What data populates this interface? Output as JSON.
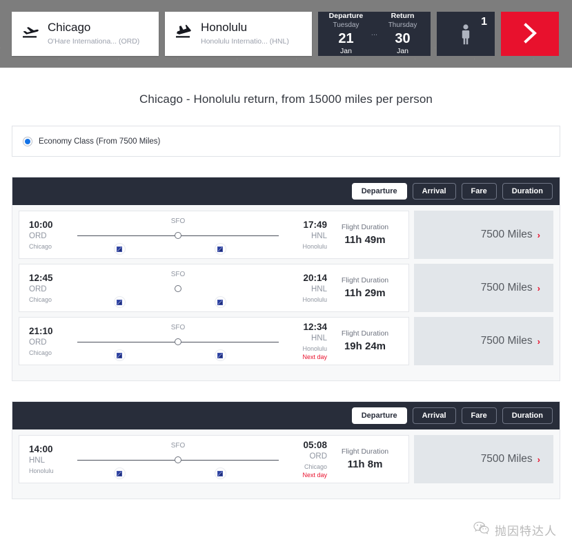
{
  "header": {
    "origin": {
      "icon": "plane-takeoff-icon",
      "city": "Chicago",
      "airport": "O'Hare Internationa... (ORD)"
    },
    "destination": {
      "icon": "plane-landing-icon",
      "city": "Honolulu",
      "airport": "Honolulu Internatio... (HNL)"
    },
    "dates": {
      "departure_label": "Departure",
      "departure_dow": "Tuesday",
      "departure_day": "21",
      "departure_month": "Jan",
      "separator": "...",
      "return_label": "Return",
      "return_dow": "Thursday",
      "return_day": "30",
      "return_month": "Jan"
    },
    "passengers": {
      "count": "1",
      "icon": "person-icon"
    },
    "submit": {
      "icon": "chevron-right-icon",
      "color": "#e8112d"
    }
  },
  "page_title": "Chicago - Honolulu return, from 15000 miles per person",
  "cabin": {
    "selected": true,
    "label": "Economy Class (From 7500 Miles)"
  },
  "sort_tabs": [
    {
      "label": "Departure",
      "active": true
    },
    {
      "label": "Arrival",
      "active": false
    },
    {
      "label": "Fare",
      "active": false
    },
    {
      "label": "Duration",
      "active": false
    }
  ],
  "outbound": {
    "flights": [
      {
        "depart_time": "10:00",
        "depart_code": "ORD",
        "depart_city": "Chicago",
        "stop": "SFO",
        "has_line": true,
        "arrive_time": "17:49",
        "arrive_code": "HNL",
        "arrive_city": "Honolulu",
        "next_day": "",
        "duration_label": "Flight Duration",
        "duration_value": "11h 49m",
        "price": "7500 Miles"
      },
      {
        "depart_time": "12:45",
        "depart_code": "ORD",
        "depart_city": "Chicago",
        "stop": "SFO",
        "has_line": false,
        "arrive_time": "20:14",
        "arrive_code": "HNL",
        "arrive_city": "Honolulu",
        "next_day": "",
        "duration_label": "Flight Duration",
        "duration_value": "11h 29m",
        "price": "7500 Miles"
      },
      {
        "depart_time": "21:10",
        "depart_code": "ORD",
        "depart_city": "Chicago",
        "stop": "SFO",
        "has_line": true,
        "arrive_time": "12:34",
        "arrive_code": "HNL",
        "arrive_city": "Honolulu",
        "next_day": "Next day",
        "duration_label": "Flight Duration",
        "duration_value": "19h 24m",
        "price": "7500 Miles"
      }
    ]
  },
  "inbound": {
    "flights": [
      {
        "depart_time": "14:00",
        "depart_code": "HNL",
        "depart_city": "Honolulu",
        "stop": "SFO",
        "has_line": true,
        "arrive_time": "05:08",
        "arrive_code": "ORD",
        "arrive_city": "Chicago",
        "next_day": "Next day",
        "duration_label": "Flight Duration",
        "duration_value": "11h 8m",
        "price": "7500 Miles"
      }
    ]
  },
  "watermark": {
    "icon": "wechat-icon",
    "text": "抛因特达人"
  },
  "chevron": "›"
}
